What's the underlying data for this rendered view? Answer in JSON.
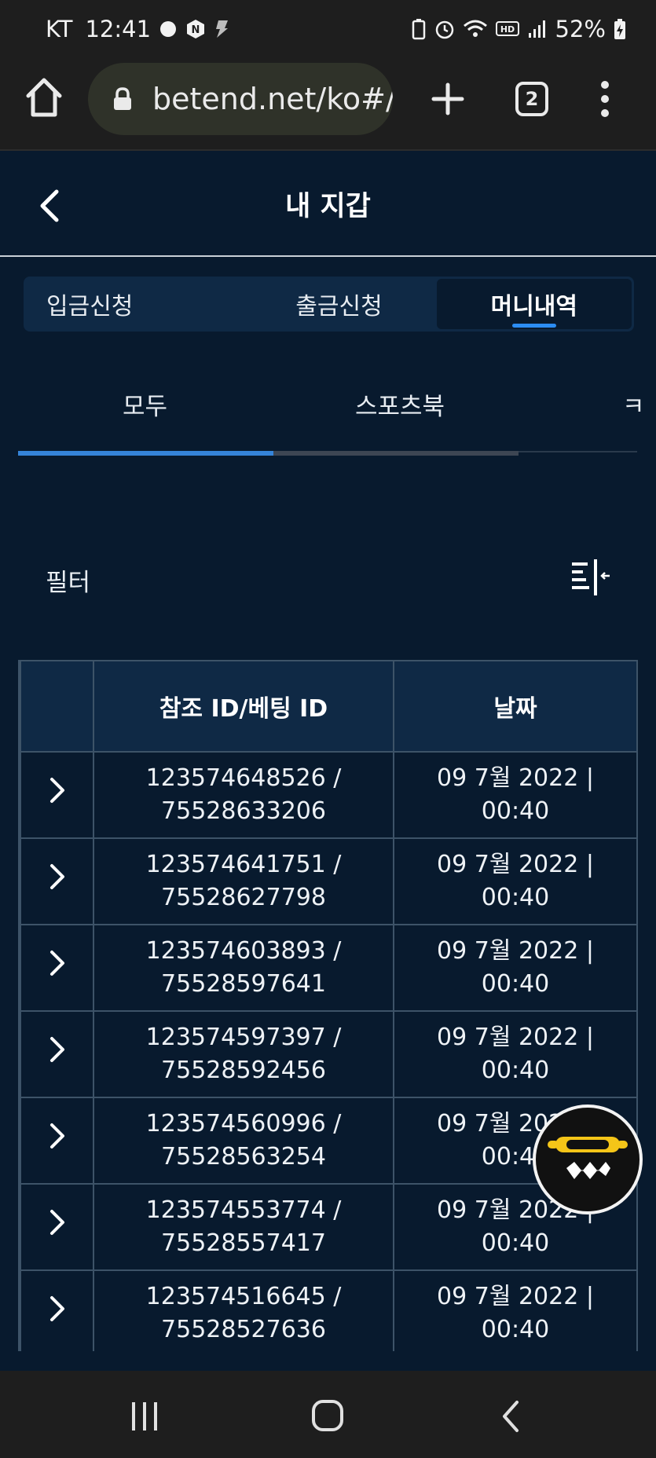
{
  "status_bar": {
    "carrier": "KT",
    "time": "12:41",
    "battery": "52%",
    "network_badge": "HD"
  },
  "browser": {
    "url": "betend.net/ko#/",
    "tab_count": "2"
  },
  "header": {
    "title": "내 지갑"
  },
  "segment_tabs": [
    {
      "label": "입금신청",
      "active": false
    },
    {
      "label": "출금신청",
      "active": false
    },
    {
      "label": "머니내역",
      "active": true
    }
  ],
  "sub_tabs": [
    {
      "label": "모두",
      "active": true
    },
    {
      "label": "스포츠북",
      "active": false
    },
    {
      "label": "ㅋ",
      "active": false
    }
  ],
  "filter": {
    "label": "필터"
  },
  "table": {
    "headers": [
      "",
      "참조 ID/베팅 ID",
      "날짜"
    ],
    "rows": [
      {
        "ref": "123574648526 /",
        "bet": "75528633206",
        "date": "09 7월 2022 |",
        "time": "00:40"
      },
      {
        "ref": "123574641751 /",
        "bet": "75528627798",
        "date": "09 7월 2022 |",
        "time": "00:40"
      },
      {
        "ref": "123574603893 /",
        "bet": "75528597641",
        "date": "09 7월 2022 |",
        "time": "00:40"
      },
      {
        "ref": "123574597397 /",
        "bet": "75528592456",
        "date": "09 7월 2022 |",
        "time": "00:40"
      },
      {
        "ref": "123574560996 /",
        "bet": "75528563254",
        "date": "09 7월 2022 |",
        "time": "00:40"
      },
      {
        "ref": "123574553774 /",
        "bet": "75528557417",
        "date": "09 7월 2022 |",
        "time": "00:40"
      },
      {
        "ref": "123574516645 /",
        "bet": "75528527636",
        "date": "09 7월 2022 |",
        "time": "00:40"
      }
    ]
  },
  "colors": {
    "page_bg": "#081a2e",
    "panel_bg": "#0f2945",
    "accent": "#2c8df2",
    "system_bar": "#1e1e1e",
    "widget_yellow": "#f5c518"
  },
  "icons": {
    "browser": [
      "home-icon",
      "lock-icon",
      "plus-icon",
      "tabs-icon",
      "more-vert-icon"
    ],
    "header": "chevron-left-icon",
    "filter": "filter-collapse-icon",
    "row": "chevron-right-icon",
    "widget": "chat-widget-icon",
    "nav": [
      "recents-icon",
      "home-circle-icon",
      "back-icon"
    ]
  }
}
